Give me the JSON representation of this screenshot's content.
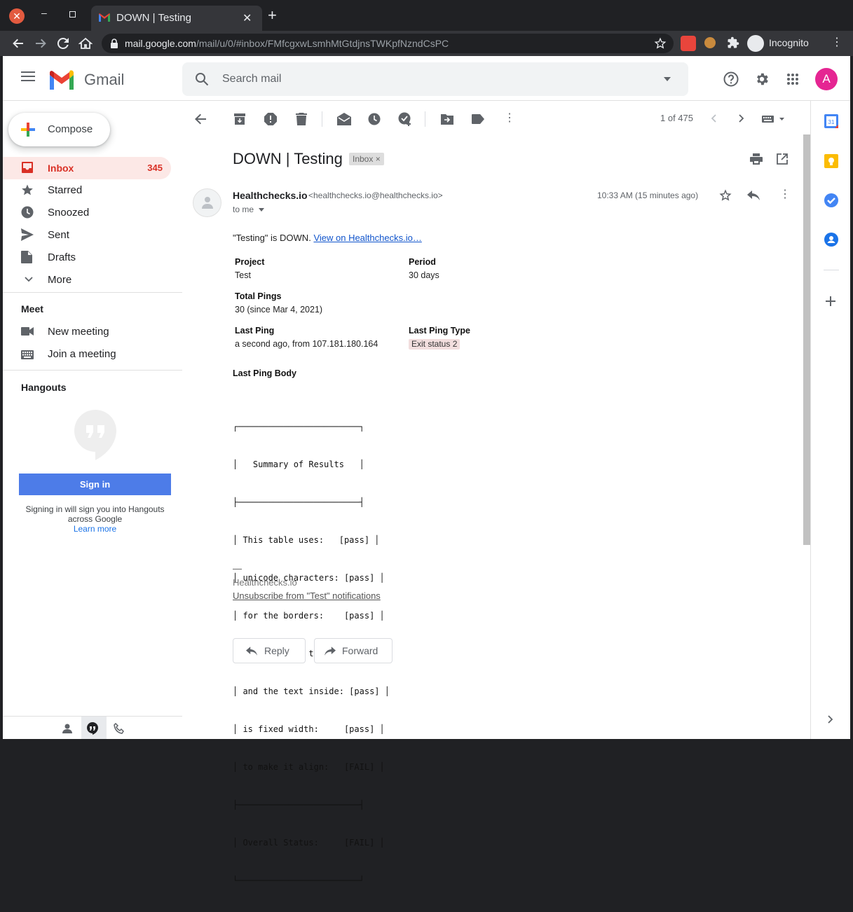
{
  "browser": {
    "tab_title": "DOWN | Testing",
    "url_host": "mail.google.com",
    "url_path": "/mail/u/0/#inbox/FMfcgxwLsmhMtGtdjnsTWKpfNzndCsPC",
    "incognito_label": "Incognito"
  },
  "header": {
    "brand": "Gmail",
    "search_placeholder": "Search mail",
    "avatar_letter": "A"
  },
  "sidebar": {
    "compose": "Compose",
    "items": [
      {
        "label": "Inbox",
        "count": "345"
      },
      {
        "label": "Starred"
      },
      {
        "label": "Snoozed"
      },
      {
        "label": "Sent"
      },
      {
        "label": "Drafts"
      },
      {
        "label": "More"
      }
    ],
    "meet": {
      "title": "Meet",
      "new_meeting": "New meeting",
      "join_meeting": "Join a meeting"
    },
    "hangouts": {
      "title": "Hangouts",
      "sign_in": "Sign in",
      "note": "Signing in will sign you into Hangouts across Google",
      "learn_more": "Learn more"
    }
  },
  "toolbar": {
    "pager": "1 of 475"
  },
  "message": {
    "subject": "DOWN | Testing",
    "label_chip": "Inbox",
    "sender_name": "Healthchecks.io",
    "sender_email": "<healthchecks.io@healthchecks.io>",
    "to": "to me",
    "time": "10:33 AM (15 minutes ago)",
    "intro_text": "\"Testing\" is DOWN.",
    "intro_link": "View on Healthchecks.io…",
    "fields": {
      "project_label": "Project",
      "project_value": "Test",
      "period_label": "Period",
      "period_value": "30 days",
      "total_pings_label": "Total Pings",
      "total_pings_value": "30 (since Mar 4, 2021)",
      "last_ping_label": "Last Ping",
      "last_ping_value": "a second ago, from 107.181.180.164",
      "last_ping_type_label": "Last Ping Type",
      "last_ping_type_value": "Exit status 2"
    },
    "body_title": "Last Ping Body",
    "body_lines": [
      "┌────────────────────────┐",
      "│   Summary of Results   │",
      "├────────────────────────┤",
      "│ This table uses:   [pass] │",
      "│ unicode characters: [pass] │",
      "│ for the borders:    [pass] │",
      "│ which should touch: [FAIL] │",
      "│ and the text inside: [pass] │",
      "│ is fixed width:     [pass] │",
      "│ to make it align:   [FAIL] │",
      "├────────────────────────┤",
      "│ Overall Status:     [FAIL] │",
      "└────────────────────────┘"
    ],
    "signature_dash": "—",
    "signature_name": "Healthchecks.io",
    "unsubscribe": "Unsubscribe from \"Test\" notifications",
    "reply": "Reply",
    "forward": "Forward"
  },
  "colors": {
    "gmail_red": "#d93025",
    "inbox_highlight": "#fce8e6",
    "sign_in_blue": "#4d7ce8",
    "avatar_pink": "#e52592"
  }
}
